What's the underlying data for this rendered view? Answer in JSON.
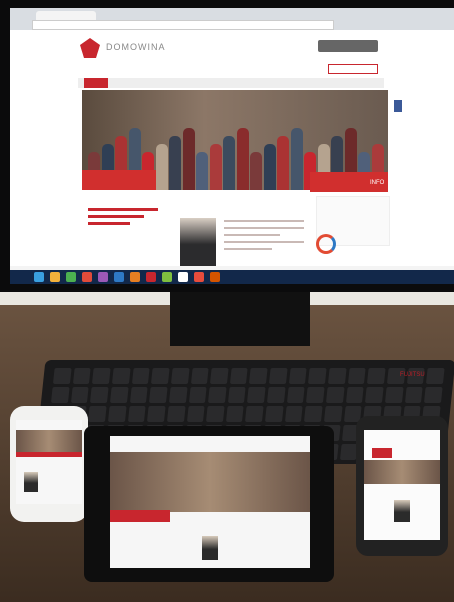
{
  "site": {
    "brand": "DOMOWINA",
    "section_label": "INFO",
    "keyboard_brand": "FUJITSU"
  },
  "colors": {
    "brand_red": "#c8262e",
    "taskbar": "#12284a",
    "facebook": "#3b5998"
  },
  "icons": [
    "domowina-logo-icon",
    "facebook-icon"
  ]
}
